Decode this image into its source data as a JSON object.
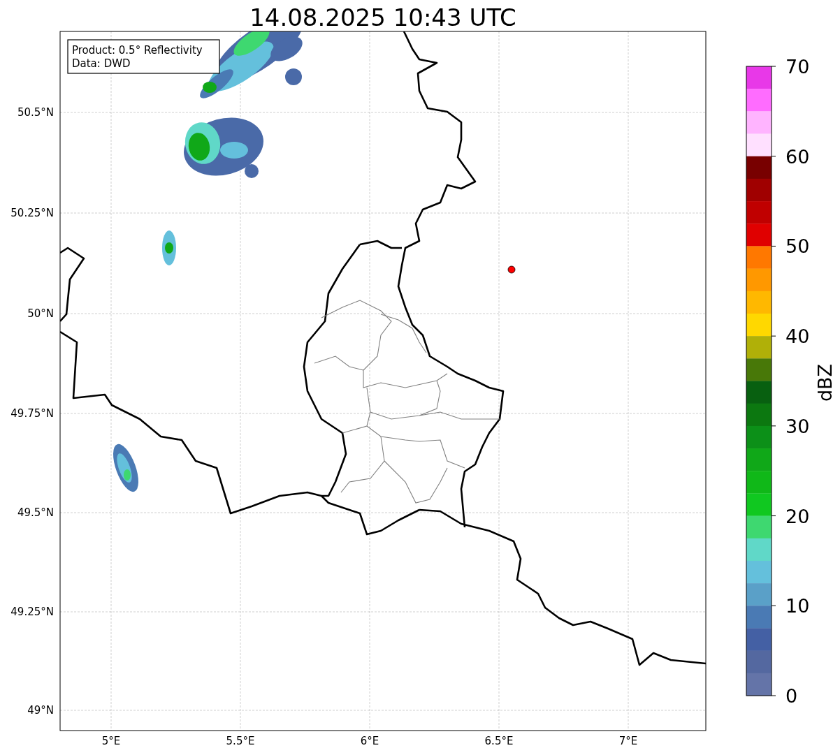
{
  "title": "14.08.2025 10:43 UTC",
  "info_box": [
    "Product: 0.5° Reflectivity",
    "Data: DWD"
  ],
  "map": {
    "yticks": [
      "50.5°N",
      "50.25°N",
      "50°N",
      "49.75°N",
      "49.5°N",
      "49.25°N",
      "49°N"
    ],
    "xticks": [
      "5°E",
      "5.5°E",
      "6°E",
      "6.5°E",
      "7°E"
    ]
  },
  "colorbar": {
    "label": "dBZ",
    "ticks": [
      "70",
      "60",
      "50",
      "40",
      "30",
      "20",
      "10",
      "0"
    ],
    "bins": [
      {
        "color": "#e838e8"
      },
      {
        "color": "#ff6cff"
      },
      {
        "color": "#ffb4ff"
      },
      {
        "color": "#ffe0ff"
      },
      {
        "color": "#780000"
      },
      {
        "color": "#a00000"
      },
      {
        "color": "#c00000"
      },
      {
        "color": "#e00000"
      },
      {
        "color": "#ff7800"
      },
      {
        "color": "#ff9800"
      },
      {
        "color": "#ffb800"
      },
      {
        "color": "#ffd800"
      },
      {
        "color": "#b0b008"
      },
      {
        "color": "#487808"
      },
      {
        "color": "#086010"
      },
      {
        "color": "#0c7810"
      },
      {
        "color": "#0c9018"
      },
      {
        "color": "#10a818"
      },
      {
        "color": "#10b818"
      },
      {
        "color": "#10c820"
      },
      {
        "color": "#3ed870"
      },
      {
        "color": "#60d8c8"
      },
      {
        "color": "#64c0dc"
      },
      {
        "color": "#5aa0c8"
      },
      {
        "color": "#4a7ab4"
      },
      {
        "color": "#4460a4"
      },
      {
        "color": "#5468a0"
      },
      {
        "color": "#6474a8"
      }
    ]
  }
}
